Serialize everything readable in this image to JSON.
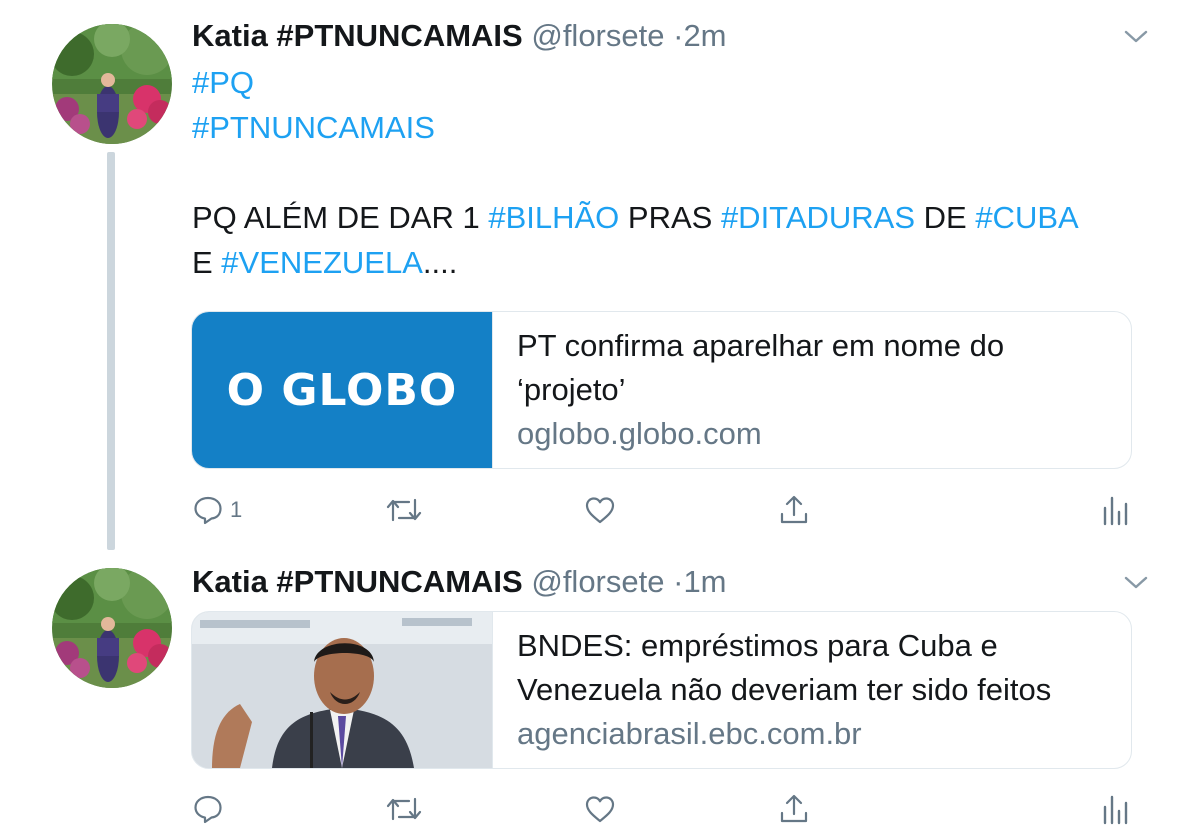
{
  "tweets": [
    {
      "name": "Katia #PTNUNCAMAIS",
      "handle": "@florsete",
      "dot": "·",
      "time": "2m",
      "text": {
        "line1": "#PQ",
        "line2": "#PTNUNCAMAIS",
        "line3_a": "PQ ALÉM DE DAR 1 ",
        "line3_b": "#BILHÃO",
        "line3_c": " PRAS ",
        "line3_d": "#DITADURAS",
        "line3_e": " DE ",
        "line3_f": "#CUBA",
        "line4_a": "E ",
        "line4_b": "#VENEZUELA",
        "line4_c": "...."
      },
      "card": {
        "image_text": "O GLOBO",
        "title_line1": "PT confirma aparelhar em nome do",
        "title_line2": "‘projeto’",
        "domain": "oglobo.globo.com"
      },
      "reply_count": "1"
    },
    {
      "name": "Katia #PTNUNCAMAIS",
      "handle": "@florsete",
      "dot": "·",
      "time": "1m",
      "card": {
        "title_line1": "BNDES: empréstimos para Cuba e",
        "title_line2": "Venezuela não deveriam ter sido feitos",
        "domain": "agenciabrasil.ebc.com.br"
      },
      "reply_count": ""
    }
  ],
  "colors": {
    "link": "#1da1f2",
    "secondary": "#657786",
    "globo_blue": "#1480c6",
    "border": "#e1e8ed"
  },
  "icons": [
    "reply-icon",
    "retweet-icon",
    "like-icon",
    "share-icon",
    "analytics-icon",
    "chevron-down-icon"
  ]
}
